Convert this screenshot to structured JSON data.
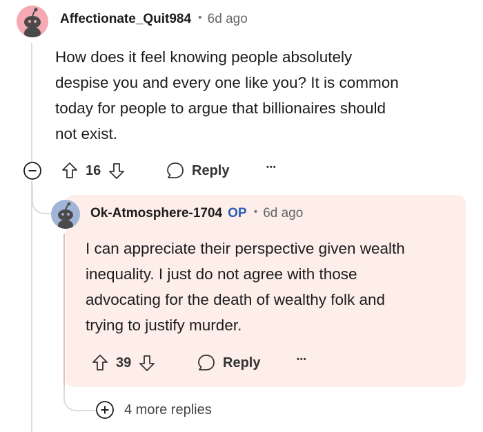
{
  "comment": {
    "username": "Affectionate_Quit984",
    "separator": "•",
    "time": "6d ago",
    "body_lines": [
      "How does it feel knowing people absolutely",
      "despise you and every one like you? It is common",
      "today for people to argue that billionaires should",
      "not exist."
    ],
    "votes": "16",
    "reply_label": "Reply",
    "more_label": "•••"
  },
  "reply": {
    "username": "Ok-Atmosphere-1704",
    "op_badge": "OP",
    "separator": "•",
    "time": "6d ago",
    "body_lines": [
      "I can appreciate their perspective given wealth",
      "inequality. I just do not agree with those",
      "advocating for the death of wealthy folk and",
      "trying to justify murder."
    ],
    "votes": "39",
    "reply_label": "Reply",
    "more_label": "•••"
  },
  "more_replies": {
    "label": "4 more replies"
  },
  "colors": {
    "nested_background": "#fdeeea",
    "op_badge": "#2c5db5",
    "avatar_1": "#f4a9b3",
    "avatar_2": "#9fb4d6"
  },
  "icons": {
    "collapse": "minus-circle-icon",
    "upvote": "arrow-up-icon",
    "downvote": "arrow-down-icon",
    "reply": "speech-bubble-icon",
    "expand": "plus-circle-icon"
  }
}
